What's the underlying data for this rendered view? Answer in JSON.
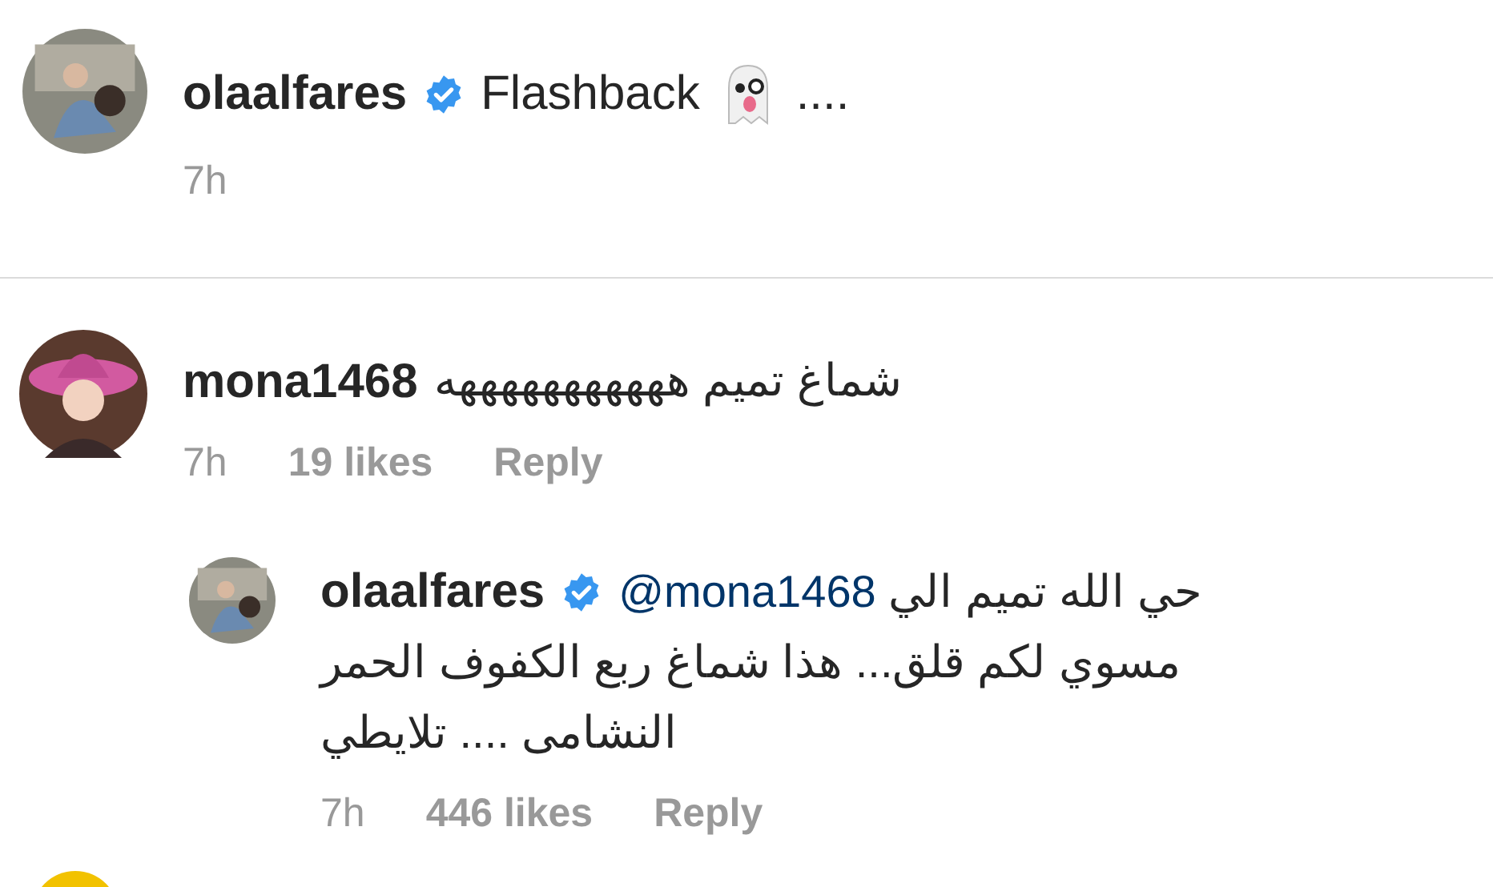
{
  "post": {
    "username": "olaalfares",
    "verified": true,
    "caption_start": "Flashback",
    "caption_end": "....",
    "time": "7h"
  },
  "comments": [
    {
      "username": "mona1468",
      "verified": false,
      "text": "شماغ تميم هههههههههههه",
      "time": "7h",
      "likes": "19 likes",
      "reply": "Reply",
      "replies": [
        {
          "username": "olaalfares",
          "verified": true,
          "mention": "@mona1468",
          "text_first_line": "حي الله تميم الي",
          "text_rest": "مسوي لكم قلق... هذا شماغ ربع الكفوف الحمر النشامى .... تلايطي",
          "time": "7h",
          "likes": "446 likes",
          "reply": "Reply"
        }
      ]
    }
  ]
}
